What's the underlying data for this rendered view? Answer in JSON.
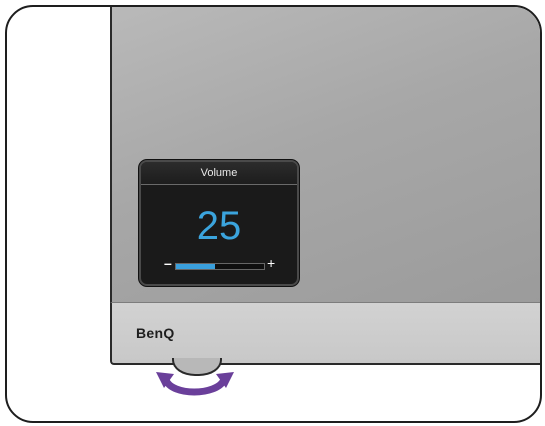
{
  "brand": {
    "logo_text": "BenQ"
  },
  "osd": {
    "title": "Volume",
    "value": "25",
    "level_percent": 25,
    "minus_symbol": "–",
    "plus_symbol": "+",
    "accent_color": "#3ba4dd"
  },
  "control": {
    "icon": "rotate-arrows-icon",
    "color": "#6a3f9a"
  }
}
